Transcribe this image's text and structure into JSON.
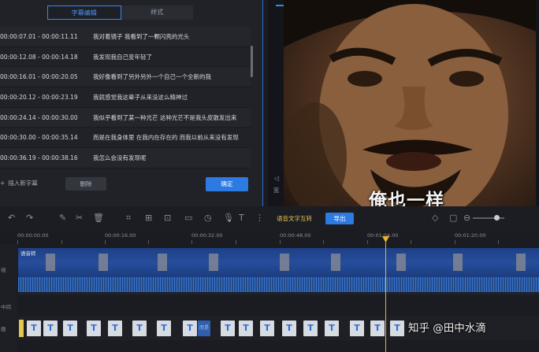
{
  "editor": {
    "tabs": [
      {
        "label": "字幕编辑",
        "active": true
      },
      {
        "label": "样式",
        "active": false
      }
    ],
    "rows": [
      {
        "time": "00:00:07.01 - 00:00:11.11",
        "text": "我对着镜子 我看到了一颗闪亮的光头"
      },
      {
        "time": "00:00:12.08 - 00:00:14.18",
        "text": "我发现我自己变年轻了"
      },
      {
        "time": "00:00:16.01 - 00:00:20.05",
        "text": "我好像看到了另外另外一个自己一个全新的我"
      },
      {
        "time": "00:00:20.12 - 00:00:23.19",
        "text": "我就感觉我这辈子从来没这么精神过"
      },
      {
        "time": "00:00:24.14 - 00:00:30.00",
        "text": "我似乎看到了某一种光芒 这种光芒不是我头皮散发出来"
      },
      {
        "time": "00:00:30.00 - 00:00:35.14",
        "text": "而是在我身体里 在我内在存在的 而我以前从来没有发现"
      },
      {
        "time": "00:00:36.19 - 00:00:38.16",
        "text": "我怎么会没有发现呢"
      }
    ],
    "add_label": "插入新字幕",
    "delete_label": "删除",
    "confirm_label": "确定"
  },
  "preview": {
    "side_label": "宽",
    "caption": "俺也一样"
  },
  "toolbar": {
    "speech_to_text": "语音文字互转",
    "export_label": "导出"
  },
  "ruler": {
    "ticks": [
      "00:00:00.00",
      "00:00:16.00",
      "00:00:32.00",
      "00:00:48.00",
      "00:01:04.00",
      "00:01:20.00"
    ]
  },
  "tracks": {
    "video_clip_label": "语音转",
    "video_side": "视",
    "middle_side": "中间",
    "text_side": "画",
    "text_block_glyph": "T",
    "text_block_tag": "而是"
  },
  "watermark": "知乎 @田中水滴",
  "colors": {
    "accent": "#2d7ae3",
    "playhead": "#f0b428"
  }
}
